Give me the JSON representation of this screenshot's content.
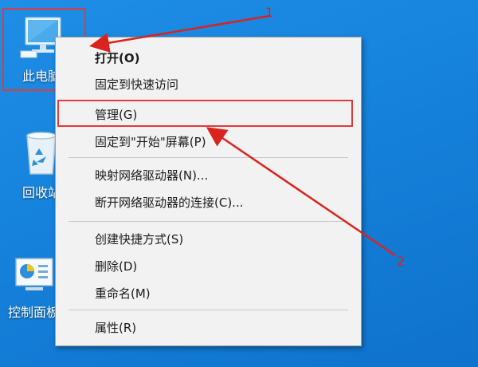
{
  "desktop": {
    "background": "#1683dc",
    "icons": [
      {
        "label": "此电脑",
        "icon": "this-pc-icon"
      },
      {
        "label": "回收站",
        "icon": "recycle-bin-icon"
      },
      {
        "label": "控制面板",
        "icon": "control-panel-icon"
      }
    ]
  },
  "context_menu": {
    "items": [
      {
        "label": "打开(O)",
        "bold": true
      },
      {
        "label": "固定到快速访问"
      },
      {
        "label": "管理(G)",
        "highlighted": true
      },
      {
        "label": "固定到\"开始\"屏幕(P)"
      },
      {
        "label": "映射网络驱动器(N)..."
      },
      {
        "label": "断开网络驱动器的连接(C)..."
      },
      {
        "label": "创建快捷方式(S)"
      },
      {
        "label": "删除(D)"
      },
      {
        "label": "重命名(M)"
      },
      {
        "label": "属性(R)"
      }
    ]
  },
  "annotations": {
    "color": "#d9231f",
    "step1": "1",
    "step2": "2"
  }
}
